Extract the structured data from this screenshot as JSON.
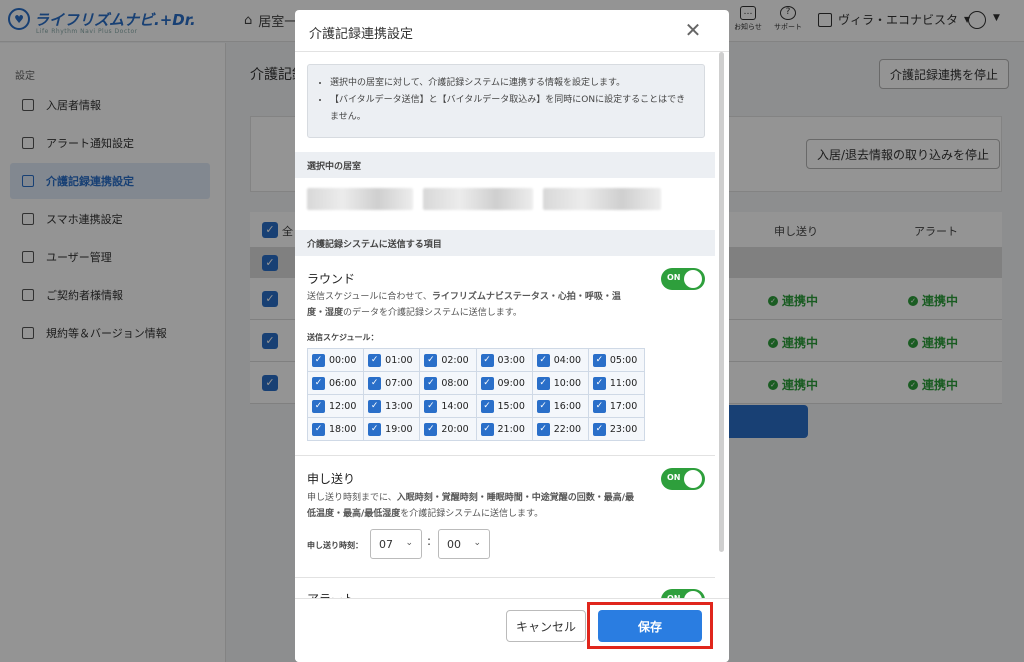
{
  "app": {
    "logo_text": "ライフリズムナビ.+Dr.",
    "logo_sub": "Life Rhythm Navi Plus Doctor",
    "nav_home": "居室一",
    "notifications_label": "お知らせ",
    "support_label": "サポート",
    "facility_name": "ヴィラ・エコナビスタ"
  },
  "sidebar": {
    "heading": "設定",
    "items": [
      {
        "label": "入居者情報"
      },
      {
        "label": "アラート通知設定"
      },
      {
        "label": "介護記録連携設定"
      },
      {
        "label": "スマホ連携設定"
      },
      {
        "label": "ユーザー管理"
      },
      {
        "label": "ご契約者様情報"
      },
      {
        "label": "規約等＆バージョン情報"
      }
    ]
  },
  "main": {
    "title": "介護記録",
    "stop_link_button": "介護記録連携を停止",
    "stop_import_button": "入居/退去情報の取り込みを停止",
    "select_all": "全",
    "col_handover": "申し送り",
    "col_alert": "アラート",
    "status_linked": "連携中"
  },
  "modal": {
    "title": "介護記録連携設定",
    "close": "✕",
    "info": [
      "選択中の居室に対して、介護記録システムに連携する情報を設定します。",
      "【バイタルデータ送信】と【バイタルデータ取込み】を同時にONに設定することはできません。"
    ],
    "selected_rooms_heading": "選択中の居室",
    "send_items_heading": "介護記録システムに送信する項目",
    "round": {
      "title": "ラウンド",
      "toggle": "ON",
      "desc_pre": "送信スケジュールに合わせて、",
      "desc_bold": "ライフリズムナビステータス・心拍・呼吸・温度・湿度",
      "desc_post": "のデータを介護記録システムに送信します。",
      "schedule_label": "送信スケジュール："
    },
    "schedule": [
      [
        "00:00",
        "01:00",
        "02:00",
        "03:00",
        "04:00",
        "05:00"
      ],
      [
        "06:00",
        "07:00",
        "08:00",
        "09:00",
        "10:00",
        "11:00"
      ],
      [
        "12:00",
        "13:00",
        "14:00",
        "15:00",
        "16:00",
        "17:00"
      ],
      [
        "18:00",
        "19:00",
        "20:00",
        "21:00",
        "22:00",
        "23:00"
      ]
    ],
    "handover": {
      "title": "申し送り",
      "toggle": "ON",
      "desc_pre": "申し送り時刻までに、",
      "desc_bold": "入眠時刻・覚醒時刻・睡眠時間・中途覚醒の回数・最高/最低温度・最高/最低湿度",
      "desc_post": "を介護記録システムに送信します。",
      "time_label": "申し送り時刻：",
      "hour": "07",
      "minute": "00",
      "colon": ":"
    },
    "alert": {
      "title": "アラート",
      "toggle": "ON"
    },
    "cancel_button": "キャンセル",
    "save_button": "保存"
  },
  "colors": {
    "primary": "#2a6fc9",
    "toggle_on": "#2e9f3c",
    "save_highlight": "#e0261c"
  }
}
